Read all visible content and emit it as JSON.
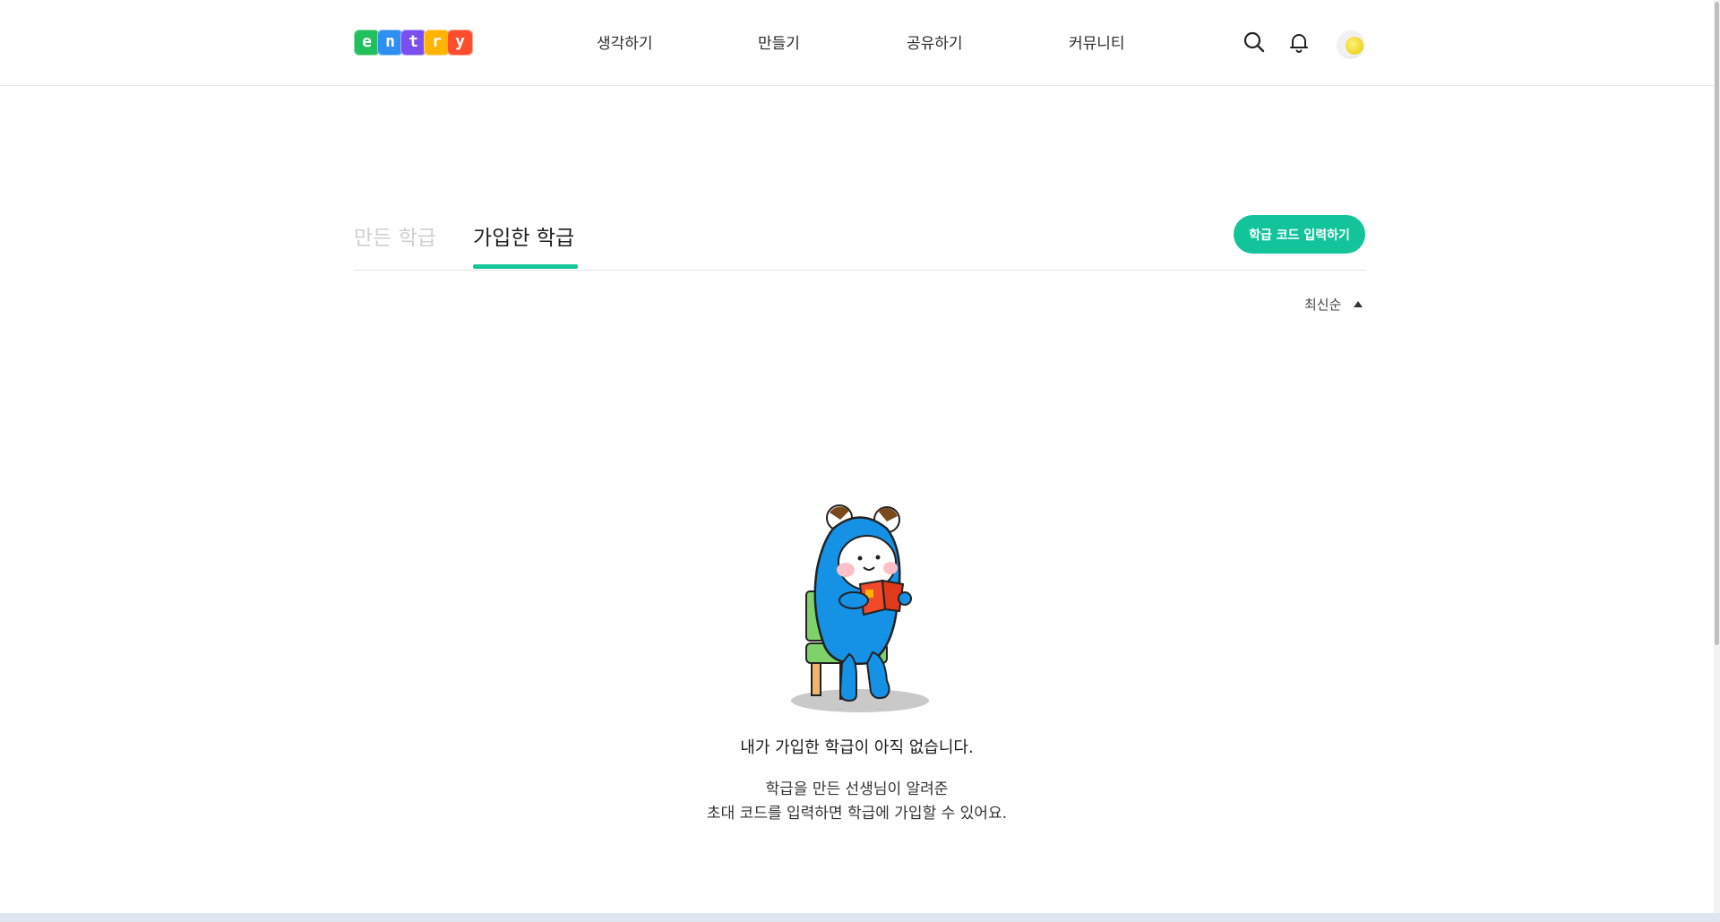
{
  "header": {
    "logo_letters": [
      "e",
      "n",
      "t",
      "r",
      "y"
    ],
    "logo_colors": [
      "#20c05c",
      "#2f8ff0",
      "#7a4ff0",
      "#ffb400",
      "#ff4e2e"
    ],
    "nav": [
      "생각하기",
      "만들기",
      "공유하기",
      "커뮤니티"
    ],
    "icons": [
      "search-icon",
      "bell-icon",
      "avatar-moon"
    ]
  },
  "tabs": [
    {
      "label": "만든 학급",
      "active": false
    },
    {
      "label": "가입한 학급",
      "active": true
    }
  ],
  "code_button_label": "학급 코드 입력하기",
  "sort": {
    "label": "최신순",
    "icon": "triangle-up-icon"
  },
  "empty": {
    "title": "내가 가입한 학급이 아직 없습니다.",
    "desc_line1": "학급을 만든 선생님이 알려준",
    "desc_line2": "초대 코드를 입력하면 학급에 가입할 수 있어요."
  },
  "colors": {
    "accent": "#16c79a",
    "inactive_tab": "#cfcfcf"
  }
}
